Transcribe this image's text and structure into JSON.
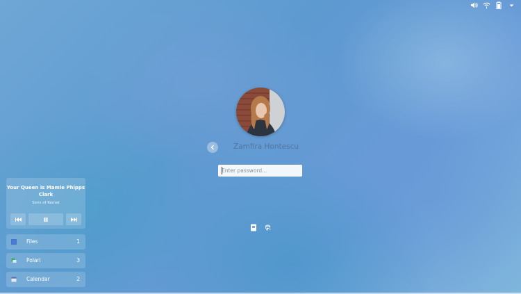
{
  "topbar": {
    "icons": [
      "volume-icon",
      "wifi-icon",
      "battery-icon",
      "chevron-down-icon"
    ]
  },
  "login": {
    "username": "Zamfira Hontescu",
    "password_placeholder": "Enter password...",
    "auth_icons": [
      "smartcard-icon",
      "fingerprint-icon"
    ]
  },
  "media": {
    "title": "Your Queen is Mamie Phipps Clark",
    "artist": "Sons of Kemet",
    "controls": [
      "previous-icon",
      "pause-icon",
      "next-icon"
    ]
  },
  "notifications": [
    {
      "name": "Files",
      "count": "1",
      "icon": "files-icon",
      "color": "#4a7bd8"
    },
    {
      "name": "Polari",
      "count": "3",
      "icon": "polari-icon",
      "color": "#3fae5b"
    },
    {
      "name": "Calendar",
      "count": "2",
      "icon": "calendar-icon",
      "color": "#5b6fb0"
    }
  ]
}
